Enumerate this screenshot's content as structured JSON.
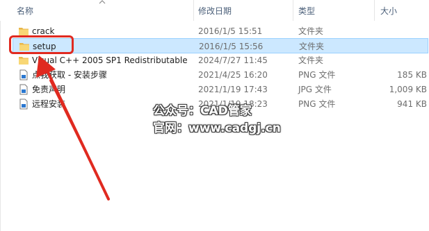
{
  "columns": {
    "name": "名称",
    "date": "修改日期",
    "type": "类型",
    "size": "大小"
  },
  "files": [
    {
      "name": "crack",
      "date": "2016/1/5 15:51",
      "type": "文件夹",
      "size": "",
      "icon": "folder-icon"
    },
    {
      "name": "setup",
      "date": "2016/1/5 15:56",
      "type": "文件夹",
      "size": "",
      "icon": "folder-icon",
      "selected": true
    },
    {
      "name": "Visual C++ 2005 SP1 Redistributable",
      "date": "2024/7/27 11:45",
      "type": "文件夹",
      "size": "",
      "icon": "folder-icon"
    },
    {
      "name": "点我获取 - 安装步骤",
      "date": "2021/4/25 16:20",
      "type": "PNG 文件",
      "size": "185 KB",
      "icon": "image-file-icon"
    },
    {
      "name": "免责声明",
      "date": "2021/1/19 17:43",
      "type": "JPG 文件",
      "size": "1,009 KB",
      "icon": "image-file-icon"
    },
    {
      "name": "远程安装",
      "date": "2021/1/19 18:23",
      "type": "PNG 文件",
      "size": "941 KB",
      "icon": "image-file-icon"
    }
  ],
  "watermark": {
    "line1": "公众号：CAD管家",
    "line2": "官网：www.cadgj.cn"
  },
  "colors": {
    "selection": "#cce8ff",
    "highlight": "#e02a20",
    "folder": "#f5c753"
  }
}
